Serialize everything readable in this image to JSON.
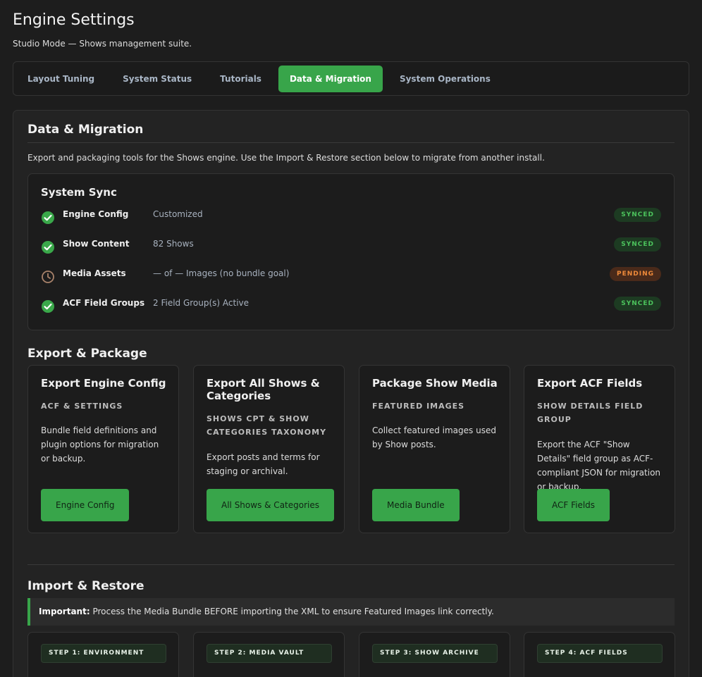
{
  "header": {
    "title": "Engine Settings",
    "subtitle": "Studio Mode — Shows management suite."
  },
  "tabs": [
    {
      "label": "Layout Tuning",
      "active": false
    },
    {
      "label": "System Status",
      "active": false
    },
    {
      "label": "Tutorials",
      "active": false
    },
    {
      "label": "Data & Migration",
      "active": true
    },
    {
      "label": "System Operations",
      "active": false
    }
  ],
  "panel": {
    "title": "Data & Migration",
    "intro": "Export and packaging tools for the Shows engine. Use the Import & Restore section below to migrate from another install."
  },
  "sync": {
    "title": "System Sync",
    "rows": [
      {
        "label": "Engine Config",
        "value": "Customized",
        "status": "SYNCED",
        "icon": "check-circle-icon"
      },
      {
        "label": "Show Content",
        "value": "82 Shows",
        "status": "SYNCED",
        "icon": "check-circle-icon"
      },
      {
        "label": "Media Assets",
        "value": "— of — Images (no bundle goal)",
        "status": "PENDING",
        "icon": "clock-icon"
      },
      {
        "label": "ACF Field Groups",
        "value": "2 Field Group(s) Active",
        "status": "SYNCED",
        "icon": "check-circle-icon"
      }
    ]
  },
  "export": {
    "title": "Export & Package",
    "cards": [
      {
        "title": "Export Engine Config",
        "sub": "ACF & SETTINGS",
        "desc": "Bundle field definitions and plugin options for migration or backup.",
        "button": "Engine Config"
      },
      {
        "title": "Export All Shows & Categories",
        "sub": "SHOWS CPT & SHOW CATEGORIES TAXONOMY",
        "desc": "Export posts and terms for staging or archival.",
        "button": "All Shows & Categories"
      },
      {
        "title": "Package Show Media",
        "sub": "FEATURED IMAGES",
        "desc": "Collect featured images used by Show posts.",
        "button": "Media Bundle"
      },
      {
        "title": "Export ACF Fields",
        "sub": "SHOW DETAILS FIELD GROUP",
        "desc": "Export the ACF \"Show Details\" field group as ACF-compliant JSON for migration or backup.",
        "button": "ACF Fields"
      }
    ]
  },
  "import": {
    "title": "Import & Restore",
    "notice_strong": "Important:",
    "notice_text": " Process the Media Bundle BEFORE importing the XML to ensure Featured Images link correctly.",
    "steps": [
      {
        "label": "STEP 1: ENVIRONMENT"
      },
      {
        "label": "STEP 2: MEDIA VAULT"
      },
      {
        "label": "STEP 3: SHOW ARCHIVE"
      },
      {
        "label": "STEP 4: ACF FIELDS"
      }
    ]
  },
  "colors": {
    "accent": "#38a54a",
    "synced": "#4cc35c",
    "pending": "#ef8a3a"
  }
}
